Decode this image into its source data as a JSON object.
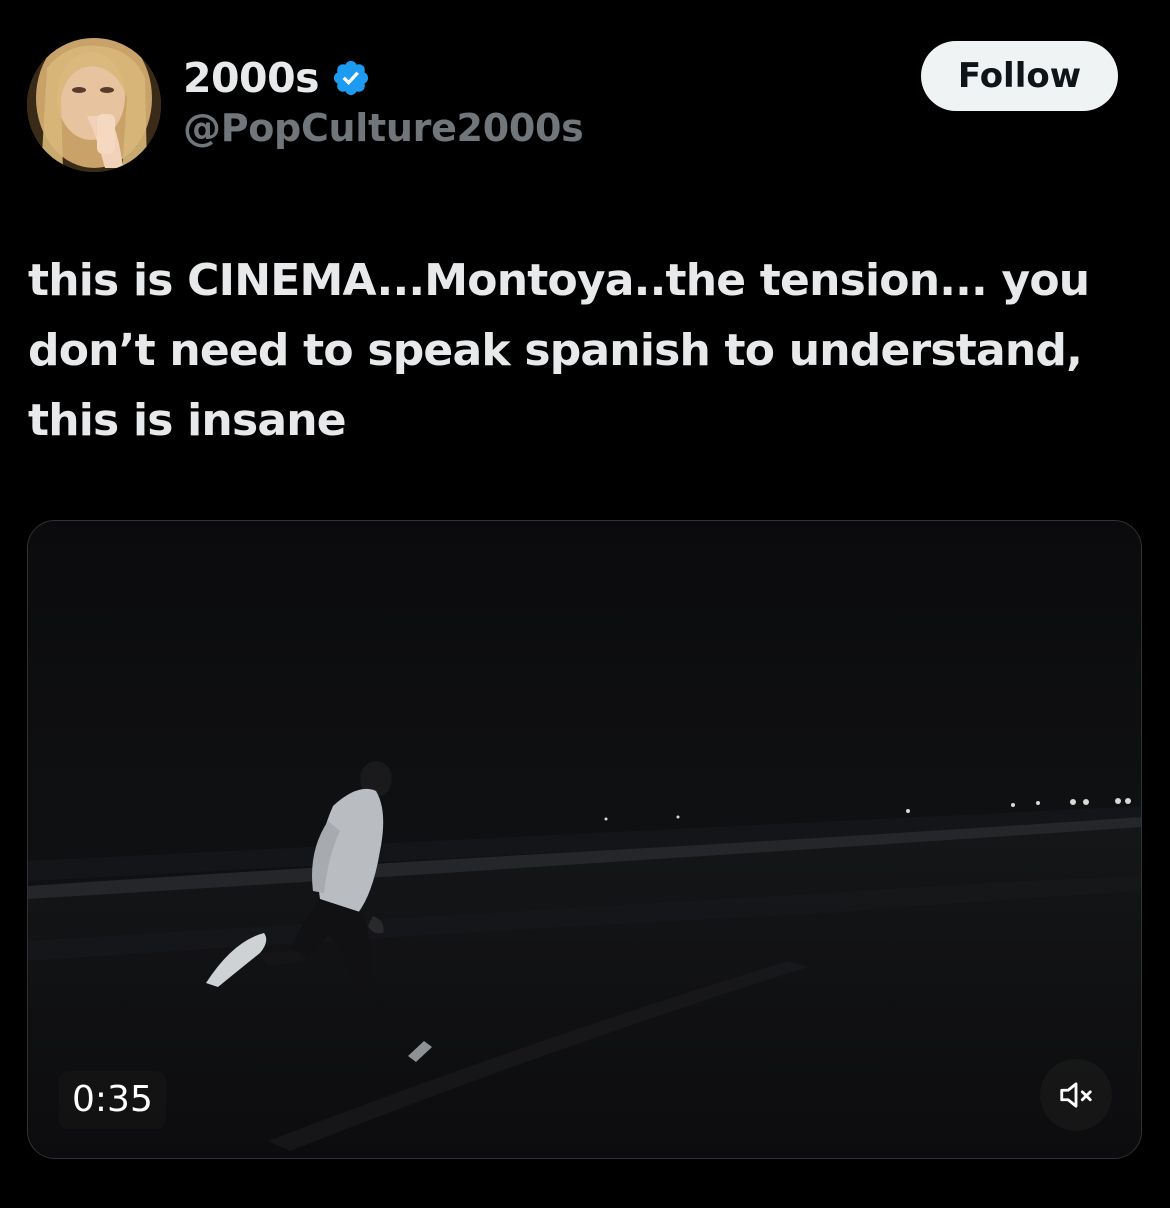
{
  "author": {
    "display_name": "2000s",
    "handle": "@PopCulture2000s",
    "verified": true,
    "avatar_icon": "avatar-photo"
  },
  "follow_button": {
    "label": "Follow"
  },
  "tweet": {
    "text": "this is CINEMA...Montoya..the tension... you\ndon’t need to speak spanish to understand,\nthis is insane"
  },
  "video": {
    "duration": "0:35",
    "mute_icon": "volume-muted-icon"
  },
  "colors": {
    "background": "#000000",
    "text": "#e7e9ea",
    "secondary_text": "#71767b",
    "verified": "#1d9bf0",
    "follow_bg": "#eff3f4"
  }
}
